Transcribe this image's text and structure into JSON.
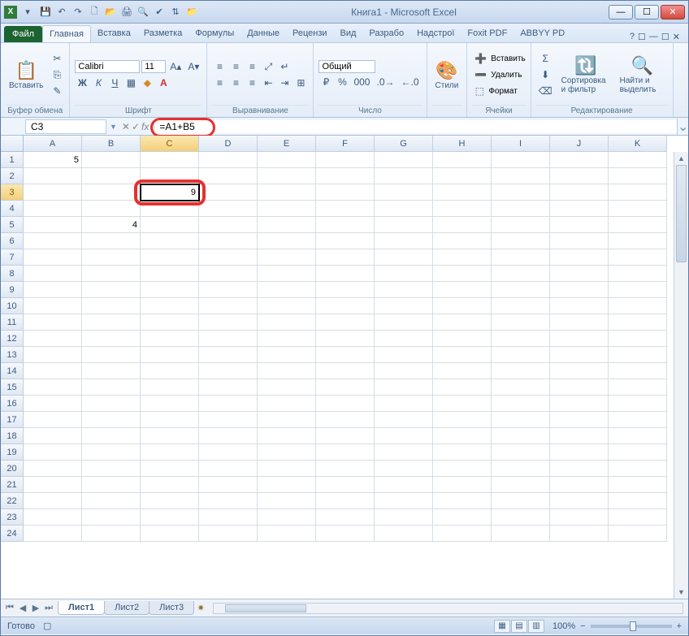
{
  "title": "Книга1 - Microsoft Excel",
  "qat_icons": [
    "save-icon",
    "undo-icon",
    "redo-icon",
    "new-icon",
    "open-icon",
    "quickprint-icon",
    "preview-icon",
    "spelling-icon",
    "sort-icon",
    "openfolder-icon"
  ],
  "tabs": {
    "file": "Файл",
    "items": [
      "Главная",
      "Вставка",
      "Разметка",
      "Формулы",
      "Данные",
      "Рецензи",
      "Вид",
      "Разрабо",
      "Надстрої",
      "Foxit PDF",
      "ABBYY PD"
    ],
    "active": 0
  },
  "ribbon": {
    "clipboard": {
      "label": "Буфер обмена",
      "paste": "Вставить"
    },
    "font": {
      "label": "Шрифт",
      "name": "Calibri",
      "size": "11"
    },
    "alignment": {
      "label": "Выравнивание"
    },
    "number": {
      "label": "Число",
      "format": "Общий"
    },
    "styles": {
      "label": "",
      "btn": "Стили"
    },
    "cells": {
      "label": "Ячейки",
      "insert": "Вставить",
      "delete": "Удалить",
      "format": "Формат"
    },
    "editing": {
      "label": "Редактирование",
      "sort": "Сортировка и фильтр",
      "find": "Найти и выделить"
    }
  },
  "namebox": "C3",
  "formula": "=A1+B5",
  "columns": [
    "A",
    "B",
    "C",
    "D",
    "E",
    "F",
    "G",
    "H",
    "I",
    "J",
    "K"
  ],
  "active_col": 2,
  "active_row": 3,
  "rows": 24,
  "cells": {
    "A1": "5",
    "B5": "4",
    "C3": "9"
  },
  "sheets": [
    "Лист1",
    "Лист2",
    "Лист3"
  ],
  "active_sheet": 0,
  "status": "Готово",
  "zoom": "100%"
}
